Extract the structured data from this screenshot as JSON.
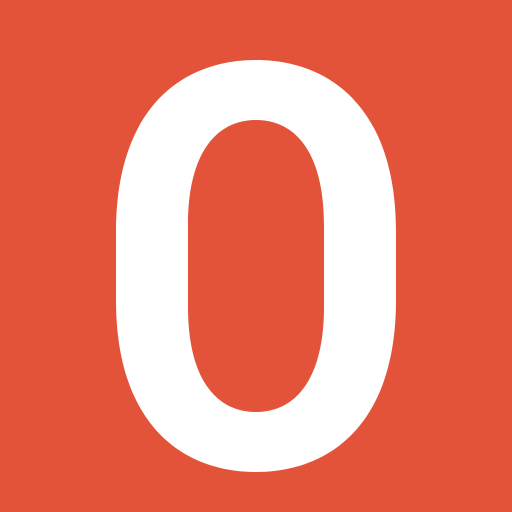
{
  "icon": {
    "name": "letter-o-icon",
    "glyph": "O",
    "background_color": "#e2533a",
    "glyph_color": "#ffffff"
  }
}
